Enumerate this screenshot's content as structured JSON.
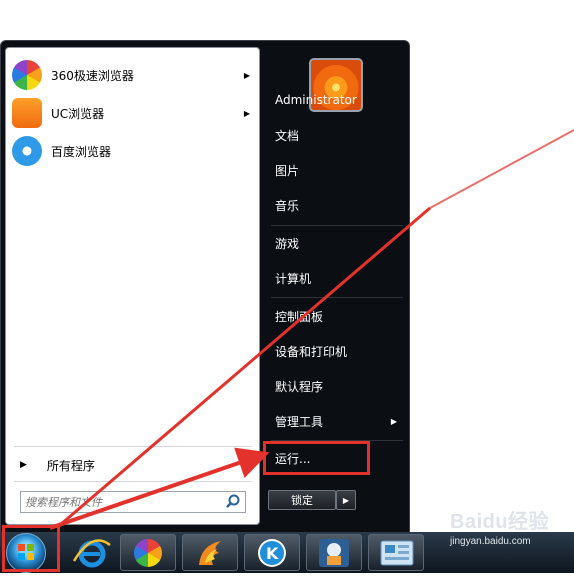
{
  "left_pane": {
    "apps": [
      {
        "label": "360极速浏览器",
        "icon": "360-browser-icon",
        "has_arrow": true
      },
      {
        "label": "UC浏览器",
        "icon": "uc-browser-icon",
        "has_arrow": true
      },
      {
        "label": "百度浏览器",
        "icon": "baidu-browser-icon",
        "has_arrow": false
      }
    ],
    "all_programs": "所有程序",
    "search_placeholder": "搜索程序和文件"
  },
  "right_pane": {
    "user": "Administrator",
    "items": [
      {
        "label": "文档"
      },
      {
        "label": "图片"
      },
      {
        "label": "音乐"
      },
      {
        "label": "游戏"
      },
      {
        "label": "计算机"
      },
      {
        "label": "控制面板"
      },
      {
        "label": "设备和打印机"
      },
      {
        "label": "默认程序"
      },
      {
        "label": "管理工具"
      },
      {
        "label": "运行..."
      }
    ],
    "shutdown_label": "锁定"
  },
  "taskbar": {
    "icons": [
      "start-orb-icon",
      "ie-icon",
      "360-browser-icon",
      "flame-app-icon",
      "k-app-icon",
      "astronaut-app-icon",
      "control-panel-icon"
    ]
  },
  "watermark": {
    "logo": "Baidu经验",
    "url": "jingyan.baidu.com"
  },
  "colors": {
    "highlight": "#e3322b",
    "menu_bg": "#0b0f14",
    "taskbar_bg": "#1a2633"
  }
}
